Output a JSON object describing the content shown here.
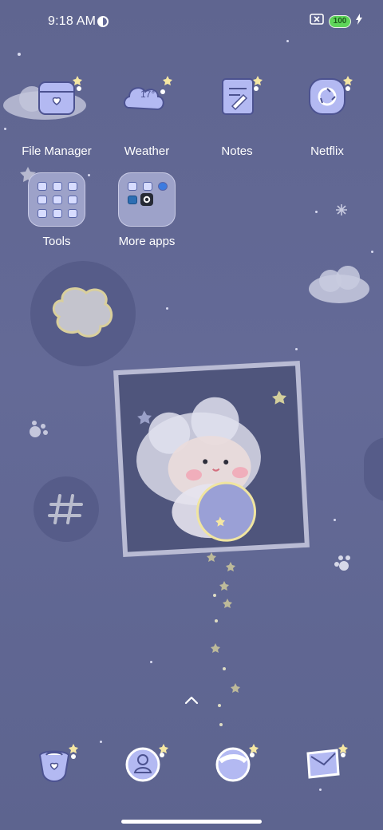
{
  "status_bar": {
    "time": "9:18 AM",
    "battery": "100"
  },
  "apps_row1": [
    {
      "label": "File Manager",
      "icon": "file-manager-icon"
    },
    {
      "label": "Weather",
      "icon": "weather-icon",
      "temp": "17°"
    },
    {
      "label": "Notes",
      "icon": "notes-icon"
    },
    {
      "label": "Netflix",
      "icon": "netflix-icon"
    }
  ],
  "folders": [
    {
      "label": "Tools"
    },
    {
      "label": "More apps"
    }
  ],
  "dock": [
    {
      "icon": "phone-icon"
    },
    {
      "icon": "contacts-icon"
    },
    {
      "icon": "browser-icon"
    },
    {
      "icon": "messages-icon"
    }
  ],
  "colors": {
    "background": "#626896",
    "icon_fill": "#b3b9f2",
    "accent_star": "#f5e7a3"
  }
}
